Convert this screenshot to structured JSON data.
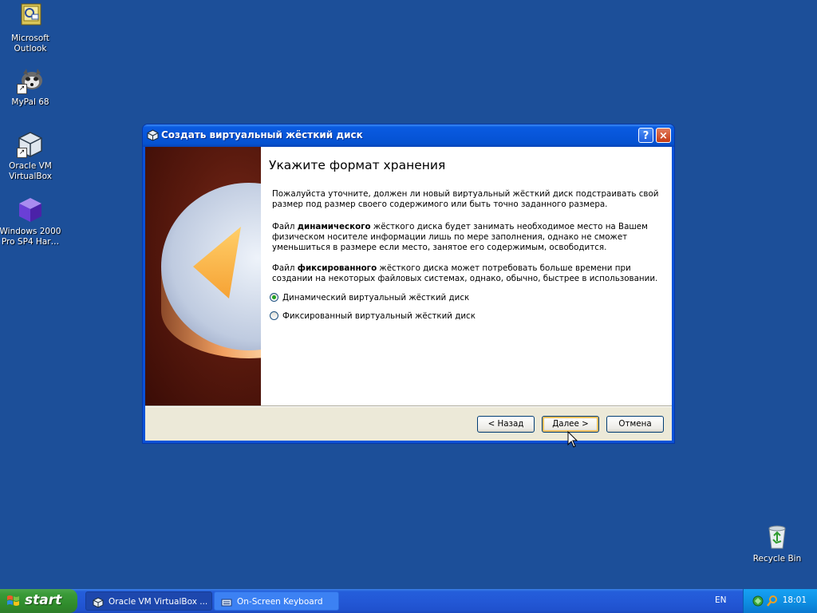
{
  "desktop": {
    "icons": [
      {
        "label": "Microsoft Outlook",
        "icon": "outlook-icon"
      },
      {
        "label": "MyPal 68",
        "icon": "mypal-icon"
      },
      {
        "label": "Oracle VM VirtualBox",
        "icon": "virtualbox-icon"
      },
      {
        "label": "Windows 2000 Pro SP4 Har…",
        "icon": "vm-box-icon"
      },
      {
        "label": "Recycle Bin",
        "icon": "recycle-bin-icon"
      }
    ]
  },
  "dialog": {
    "title": "Создать виртуальный жёсткий диск",
    "heading": "Укажите формат хранения",
    "para1": "Пожалуйста уточните, должен ли новый виртуальный жёсткий диск подстраивать свой размер под размер своего содержимого или быть точно заданного размера.",
    "para2_prefix": "Файл ",
    "para2_bold": "динамического",
    "para2_suffix": " жёсткого диска будет занимать необходимое место на Вашем физическом носителе информации лишь по мере заполнения, однако не сможет уменьшиться в размере если место, занятое его содержимым, освободится.",
    "para3_prefix": "Файл ",
    "para3_bold": "фиксированного",
    "para3_suffix": " жёсткого диска может потребовать больше времени при создании на некоторых файловых системах, однако, обычно, быстрее в использовании.",
    "options": [
      {
        "label": "Динамический виртуальный жёсткий диск",
        "selected": true
      },
      {
        "label": "Фиксированный виртуальный жёсткий диск",
        "selected": false
      }
    ],
    "buttons": {
      "back": "< Назад",
      "next": "Далее >",
      "cancel": "Отмена"
    },
    "help_glyph": "?",
    "close_glyph": "×"
  },
  "taskbar": {
    "start_label": "start",
    "tasks": [
      {
        "label": "Oracle VM VirtualBox ...",
        "icon": "virtualbox-icon",
        "active": true
      },
      {
        "label": "On-Screen Keyboard",
        "icon": "keyboard-icon",
        "active": false
      }
    ],
    "language": "EN",
    "clock": "18:01"
  },
  "colors": {
    "desktop": "#1c4f99",
    "titlebar": "#0755d8",
    "taskbar": "#245edb",
    "start": "#3a9b38",
    "tray": "#0d8ce0"
  }
}
